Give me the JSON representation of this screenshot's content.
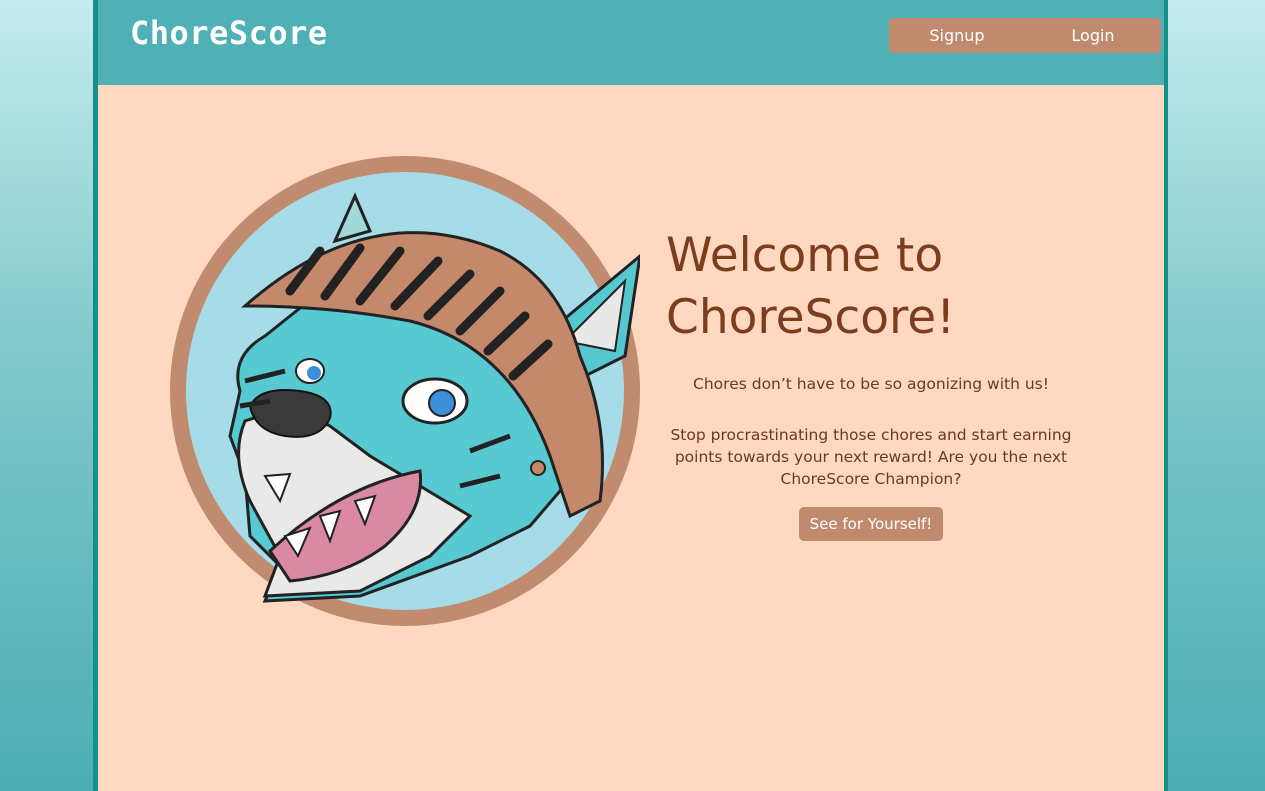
{
  "header": {
    "logo": "ChoreScore",
    "nav": {
      "signup": "Signup",
      "login": "Login"
    }
  },
  "hero": {
    "heading_line1": "Welcome to",
    "heading_line2": "ChoreScore!",
    "tagline": "Chores don’t have to be so agonizing with us!",
    "description": "Stop procrastinating those chores and start earning points towards your next reward! Are you the next ChoreScore Champion?",
    "cta_label": "See for Yourself!"
  },
  "colors": {
    "page_background": "#4aaeb4",
    "header": "#4fb0b6",
    "content_background": "#ffd8c1",
    "accent_button": "#c08a6e",
    "heading_text": "#7b3d1c"
  }
}
